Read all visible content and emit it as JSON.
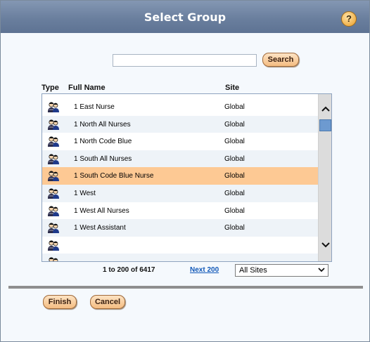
{
  "dialog": {
    "title": "Select Group",
    "help_label": "?"
  },
  "search": {
    "value": "",
    "button_label": "Search"
  },
  "columns": {
    "type": "Type",
    "full_name": "Full Name",
    "site": "Site"
  },
  "rows": [
    {
      "name": "1 East Nurse",
      "site": "Global",
      "selected": false
    },
    {
      "name": "1 North All Nurses",
      "site": "Global",
      "selected": false
    },
    {
      "name": "1 North Code Blue",
      "site": "Global",
      "selected": false
    },
    {
      "name": "1 South All Nurses",
      "site": "Global",
      "selected": false
    },
    {
      "name": "1 South Code Blue Nurse",
      "site": "Global",
      "selected": true
    },
    {
      "name": "1 West",
      "site": "Global",
      "selected": false
    },
    {
      "name": "1 West All Nurses",
      "site": "Global",
      "selected": false
    },
    {
      "name": "1 West Assistant",
      "site": "Global",
      "selected": false
    },
    {
      "name": "",
      "site": "",
      "selected": false
    },
    {
      "name": "",
      "site": "",
      "selected": false
    }
  ],
  "row_icon": "group-people-icon",
  "scrollbar": {
    "up_icon": "chevron-up-icon",
    "down_icon": "chevron-down-icon"
  },
  "pager": {
    "range_text": "1 to 200 of 6417",
    "next_label": "Next 200"
  },
  "site_filter": {
    "selected": "All Sites"
  },
  "buttons": {
    "finish": "Finish",
    "cancel": "Cancel"
  },
  "colors": {
    "titlebar": "#6a7f9e",
    "selected_row": "#fdc994",
    "button_fill": "#f4bd82",
    "link": "#1158b8"
  }
}
